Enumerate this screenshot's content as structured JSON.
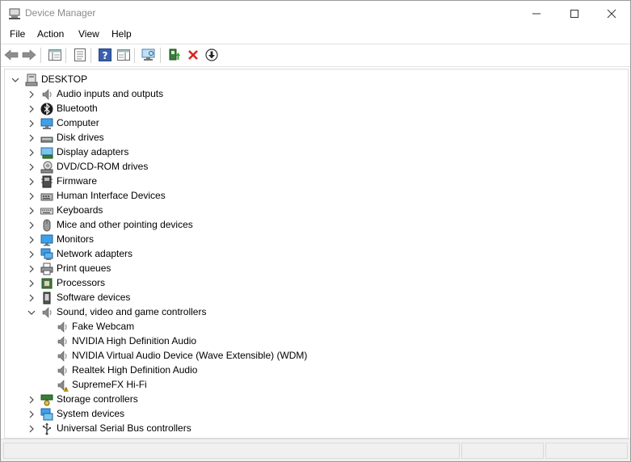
{
  "window": {
    "title": "Device Manager",
    "icon": "device-manager-icon"
  },
  "menu": [
    "File",
    "Action",
    "View",
    "Help"
  ],
  "toolbar": {
    "buttons": [
      "back-arrow-icon",
      "forward-arrow-icon",
      "show-hide-console-tree-icon",
      "properties-icon",
      "help-icon",
      "action-pane-icon",
      "scan-hardware-icon",
      "update-driver-icon",
      "uninstall-device-icon",
      "install-driver-icon"
    ]
  },
  "tree": {
    "root": "DESKTOP",
    "categories": [
      {
        "label": "Audio inputs and outputs",
        "icon": "speaker-icon",
        "expanded": false
      },
      {
        "label": "Bluetooth",
        "icon": "bluetooth-icon",
        "expanded": false
      },
      {
        "label": "Computer",
        "icon": "computer-icon",
        "expanded": false
      },
      {
        "label": "Disk drives",
        "icon": "disk-drive-icon",
        "expanded": false
      },
      {
        "label": "Display adapters",
        "icon": "display-adapter-icon",
        "expanded": false
      },
      {
        "label": "DVD/CD-ROM drives",
        "icon": "dvd-drive-icon",
        "expanded": false
      },
      {
        "label": "Firmware",
        "icon": "firmware-icon",
        "expanded": false
      },
      {
        "label": "Human Interface Devices",
        "icon": "hid-icon",
        "expanded": false
      },
      {
        "label": "Keyboards",
        "icon": "keyboard-icon",
        "expanded": false
      },
      {
        "label": "Mice and other pointing devices",
        "icon": "mouse-icon",
        "expanded": false
      },
      {
        "label": "Monitors",
        "icon": "monitor-icon",
        "expanded": false
      },
      {
        "label": "Network adapters",
        "icon": "network-adapter-icon",
        "expanded": false
      },
      {
        "label": "Print queues",
        "icon": "printer-icon",
        "expanded": false
      },
      {
        "label": "Processors",
        "icon": "processor-icon",
        "expanded": false
      },
      {
        "label": "Software devices",
        "icon": "software-device-icon",
        "expanded": false
      },
      {
        "label": "Sound, video and game controllers",
        "icon": "speaker-icon",
        "expanded": true,
        "children": [
          {
            "label": "Fake Webcam",
            "icon": "speaker-icon",
            "warning": false
          },
          {
            "label": "NVIDIA High Definition Audio",
            "icon": "speaker-icon",
            "warning": false
          },
          {
            "label": "NVIDIA Virtual Audio Device (Wave Extensible) (WDM)",
            "icon": "speaker-icon",
            "warning": false
          },
          {
            "label": "Realtek High Definition Audio",
            "icon": "speaker-icon",
            "warning": false
          },
          {
            "label": "SupremeFX Hi-Fi",
            "icon": "speaker-warning-icon",
            "warning": true
          }
        ]
      },
      {
        "label": "Storage controllers",
        "icon": "storage-controller-icon",
        "expanded": false
      },
      {
        "label": "System devices",
        "icon": "system-device-icon",
        "expanded": false
      },
      {
        "label": "Universal Serial Bus controllers",
        "icon": "usb-icon",
        "expanded": false
      }
    ]
  }
}
